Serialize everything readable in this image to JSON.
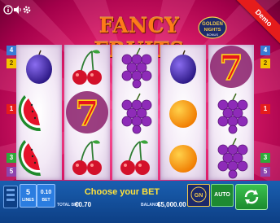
{
  "game": {
    "title": "FANCY FRUITS",
    "logo_text": "GOLDEN NIGHTS BONUS",
    "demo_label": "Demo"
  },
  "top_icons": [
    "info-icon",
    "sound-icon",
    "settings-icon"
  ],
  "line_markers": {
    "left": [
      "4",
      "2",
      "1",
      "3",
      "5"
    ],
    "right": [
      "4",
      "2",
      "1",
      "3",
      "5"
    ],
    "colors": {
      "4": "#3a7bd5",
      "2": "#f2c500",
      "1": "#e51c1c",
      "3": "#2faa3a",
      "5": "#8e44ad"
    }
  },
  "reels": [
    [
      "plum",
      "melon",
      "melon"
    ],
    [
      "cherry",
      "seven",
      "cherry"
    ],
    [
      "grape",
      "grape",
      "cherry"
    ],
    [
      "plum",
      "orange",
      "orange"
    ],
    [
      "seven",
      "grape",
      "grape"
    ]
  ],
  "controls": {
    "lines_value": "5",
    "lines_label": "LINES",
    "bet_value": "0.10",
    "bet_label": "BET",
    "message": "Choose your BET",
    "total_bet_label": "TOTAL BET",
    "total_bet_value": "€0.70",
    "balance_label": "BALANCE",
    "balance_value": "€5,000.00",
    "auto_label": "AUTO",
    "spin_icon": "spin-icon"
  },
  "colors": {
    "accent_green": "#22a33a",
    "bar_blue": "#1a5fb0",
    "message_yellow": "#ffe23a"
  }
}
